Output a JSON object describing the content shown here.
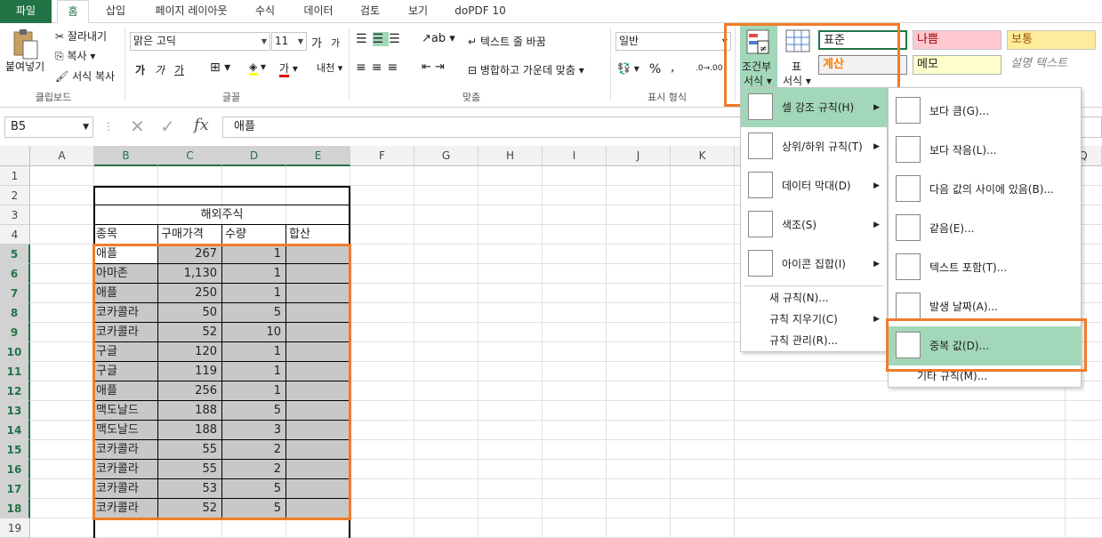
{
  "tabs": [
    "파일",
    "홈",
    "삽입",
    "페이지 레이아웃",
    "수식",
    "데이터",
    "검토",
    "보기",
    "doPDF 10"
  ],
  "clipboard": {
    "paste": "붙여넣기",
    "cut": "잘라내기",
    "copy": "복사",
    "format_painter": "서식 복사",
    "group": "클립보드"
  },
  "font": {
    "name": "맑은 고딕",
    "size": "11",
    "grow": "가",
    "shrink": "가",
    "bold": "가",
    "italic": "가",
    "underline": "가",
    "group": "글꼴"
  },
  "align": {
    "wrap": "텍스트 줄 바꿈",
    "merge": "병합하고 가운데 맞춤",
    "group": "맞춤"
  },
  "number": {
    "format": "일반",
    "percent": "%",
    "comma": ",",
    "group": "표시 형식"
  },
  "styles": {
    "conditional": "조건부",
    "conditional2": "서식",
    "table": "표",
    "table2": "서식",
    "normal": "표준",
    "bad": "나쁨",
    "neutral": "보통",
    "calc": "계산",
    "memo": "메모",
    "explain": "설명 텍스트"
  },
  "formula": {
    "namebox": "B5",
    "value": "애플",
    "fx": "fx"
  },
  "columns": [
    "A",
    "B",
    "C",
    "D",
    "E",
    "F",
    "G",
    "H",
    "I",
    "J",
    "K",
    "Q"
  ],
  "rows": [
    "1",
    "2",
    "3",
    "4",
    "5",
    "6",
    "7",
    "8",
    "9",
    "10",
    "11",
    "12",
    "13",
    "14",
    "15",
    "16",
    "17",
    "18",
    "19"
  ],
  "sheet": {
    "title": "해외주식",
    "headers": [
      "종목",
      "구매가격",
      "수량",
      "합산"
    ],
    "data": [
      [
        "애플",
        "267",
        "1"
      ],
      [
        "아마존",
        "1,130",
        "1"
      ],
      [
        "애플",
        "250",
        "1"
      ],
      [
        "코카콜라",
        "50",
        "5"
      ],
      [
        "코카콜라",
        "52",
        "10"
      ],
      [
        "구글",
        "120",
        "1"
      ],
      [
        "구글",
        "119",
        "1"
      ],
      [
        "애플",
        "256",
        "1"
      ],
      [
        "맥도날드",
        "188",
        "5"
      ],
      [
        "맥도날드",
        "188",
        "3"
      ],
      [
        "코카콜라",
        "55",
        "2"
      ],
      [
        "코카콜라",
        "55",
        "2"
      ],
      [
        "코카콜라",
        "53",
        "5"
      ],
      [
        "코카콜라",
        "52",
        "5"
      ]
    ]
  },
  "menu1": [
    "셀 강조 규칙(H)",
    "상위/하위 규칙(T)",
    "데이터 막대(D)",
    "색조(S)",
    "아이콘 집합(I)",
    "새 규칙(N)...",
    "규칙 지우기(C)",
    "규칙 관리(R)..."
  ],
  "menu2": [
    "보다 큼(G)...",
    "보다 작음(L)...",
    "다음 값의 사이에 있음(B)...",
    "같음(E)...",
    "텍스트 포함(T)...",
    "발생 날짜(A)...",
    "중복 값(D)...",
    "기타 규칙(M)..."
  ],
  "colors": {
    "excel_green": "#217346",
    "highlight": "#a3d7b9",
    "orange": "#f07c2a",
    "selection": "#c8c8c8"
  }
}
